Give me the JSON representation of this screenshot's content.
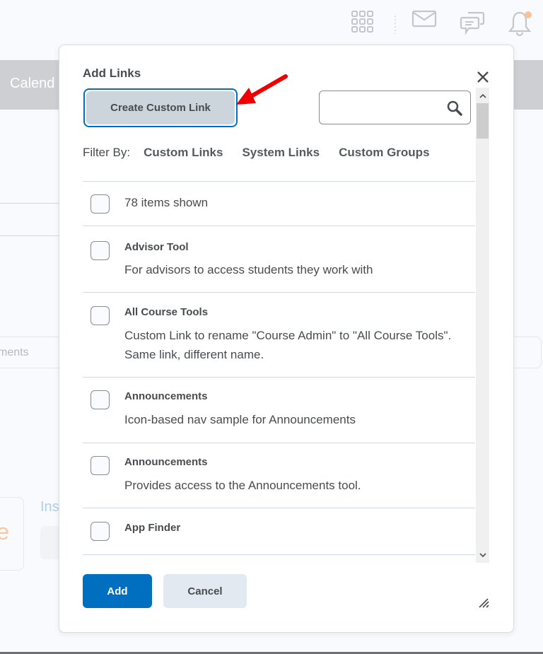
{
  "header": {
    "icons": [
      "app-grid-icon",
      "mail-icon",
      "chat-icon",
      "bell-icon"
    ],
    "notification_dot_color": "#f5c39a"
  },
  "background": {
    "nav_label": "Calend",
    "search_placeholder_fragment": "ments",
    "card_letter": "e",
    "ins_label": "Ins"
  },
  "dialog": {
    "title": "Add Links",
    "create_button_label": "Create Custom Link",
    "search": {
      "value": "",
      "placeholder": ""
    },
    "filter": {
      "label": "Filter By:",
      "options": [
        "Custom Links",
        "System Links",
        "Custom Groups"
      ]
    },
    "select_all": {
      "label": "78 items shown",
      "checked": false
    },
    "items": [
      {
        "title": "Advisor Tool",
        "description": "For advisors to access students they work with",
        "checked": false
      },
      {
        "title": "All Course Tools",
        "description": "Custom Link to rename \"Course Admin\" to \"All Course Tools\". Same link, different name.",
        "checked": false
      },
      {
        "title": "Announcements",
        "description": "Icon-based nav sample for Announcements",
        "checked": false
      },
      {
        "title": "Announcements",
        "description": "Provides access to the Announcements tool.",
        "checked": false
      },
      {
        "title": "App Finder",
        "description": "",
        "checked": false
      }
    ],
    "add_button_label": "Add",
    "cancel_button_label": "Cancel",
    "accent_color": "#006fbf",
    "annotation_arrow_color": "#ee0000"
  }
}
